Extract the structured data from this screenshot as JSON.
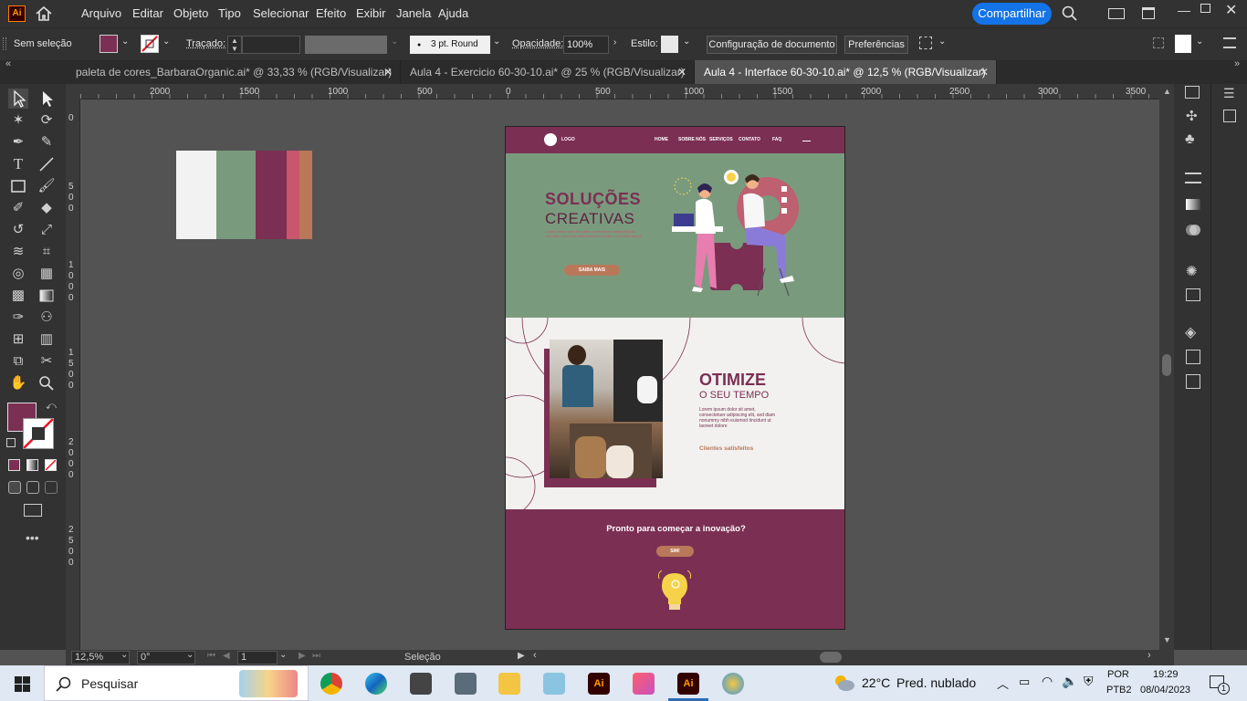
{
  "app": {
    "logo": "Ai",
    "menu": [
      "Arquivo",
      "Editar",
      "Objeto",
      "Tipo",
      "Selecionar",
      "Efeito",
      "Exibir",
      "Janela",
      "Ajuda"
    ],
    "share_button": "Compartilhar"
  },
  "control_bar": {
    "selection_label": "Sem seleção",
    "stroke_label": "Traçado:",
    "stroke_style": "3 pt. Round",
    "opacity_label": "Opacidade:",
    "opacity_value": "100%",
    "style_label": "Estilo:",
    "doc_setup_button": "Configuração de documento",
    "preferences_button": "Preferências"
  },
  "tabs": [
    {
      "label": "paleta de cores_BarbaraOrganic.ai* @ 33,33 % (RGB/Visualizar)",
      "active": false
    },
    {
      "label": "Aula 4 - Exercicio 60-30-10.ai* @ 25 % (RGB/Visualizar)",
      "active": false
    },
    {
      "label": "Aula 4 - Interface 60-30-10.ai* @ 12,5 % (RGB/Visualizar)",
      "active": true
    }
  ],
  "ruler": {
    "h_ticks": [
      "2000",
      "1500",
      "1000",
      "500",
      "0",
      "500",
      "1000",
      "1500",
      "2000",
      "2500",
      "3000",
      "3500"
    ],
    "v_ticks": [
      "0",
      "5\n0\n0",
      "1\n0\n0\n0",
      "1\n5\n0\n0",
      "2\n0\n0\n0",
      "2\n5\n0\n0"
    ]
  },
  "palette": [
    "#f2f2f2",
    "#7a9a7e",
    "#7b2f53",
    "#c9566d",
    "#b9785a"
  ],
  "colors": {
    "fill": "#7b2f53",
    "accent_blue": "#1473e6",
    "hero_green": "#7a9a7e",
    "brand_plum": "#7b2f53",
    "button_tan": "#b9785a"
  },
  "artboard": {
    "logo_text": "LOGO",
    "nav": [
      "HOME",
      "SOBRE NÓS",
      "SERVIÇOS",
      "CONTATO",
      "FAQ"
    ],
    "hero_title_1": "SOLUÇÕES",
    "hero_title_2": "CREATIVAS",
    "hero_body": "Lorem ipsum dolor sit amet, consectetuer adipiscing elit, sed diam nonummy nibh euismod tincidunt ut laoreet dolore",
    "hero_button": "SAIBA MAIS",
    "section2_title_1": "OTIMIZE",
    "section2_title_2": "O SEU TEMPO",
    "section2_body": "Lorem ipsum dolor sit amet, consectetuer adipiscing elit, sed diam nonummy nibh euismod tincidunt ut laoreet dolore",
    "section2_link": "Clientes satisfeitos",
    "cta_title": "Pronto para começar a inovação?",
    "cta_button": "SIM!"
  },
  "status": {
    "zoom": "12,5%",
    "rotation": "0°",
    "artboard_num": "1",
    "tool": "Seleção"
  },
  "taskbar": {
    "search_placeholder": "Pesquisar",
    "weather_temp": "22°C",
    "weather_desc": "Pred. nublado",
    "lang_1": "POR",
    "lang_2": "PTB2",
    "time": "19:29",
    "date": "08/04/2023",
    "notif_count": "1"
  }
}
